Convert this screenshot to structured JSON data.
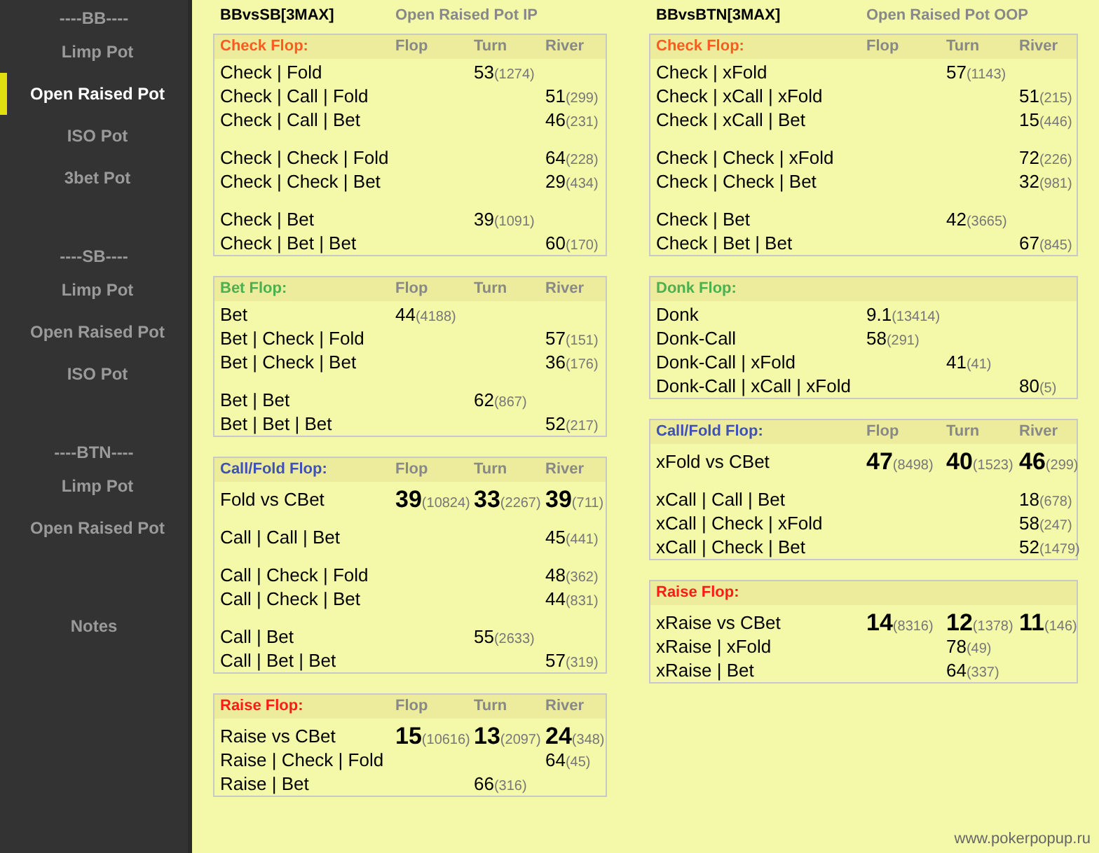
{
  "sidebar": {
    "groups": [
      {
        "heading": "----BB----",
        "items": [
          {
            "label": "Limp Pot",
            "selected": false
          },
          {
            "label": "Open Raised Pot",
            "selected": true
          },
          {
            "label": "ISO Pot",
            "selected": false
          },
          {
            "label": "3bet Pot",
            "selected": false
          }
        ]
      },
      {
        "heading": "----SB----",
        "items": [
          {
            "label": "Limp Pot",
            "selected": false
          },
          {
            "label": "Open Raised Pot",
            "selected": false
          },
          {
            "label": "ISO Pot",
            "selected": false
          }
        ]
      },
      {
        "heading": "----BTN----",
        "items": [
          {
            "label": "Limp Pot",
            "selected": false
          },
          {
            "label": "Open Raised Pot",
            "selected": false
          }
        ]
      }
    ],
    "notes": "Notes"
  },
  "panels": [
    {
      "title": "BBvsSB[3MAX]",
      "subtitle": "Open Raised Pot IP",
      "sections": [
        {
          "title": "Check Flop:",
          "color": "#ff5a1f",
          "columns": [
            "Flop",
            "Turn",
            "River"
          ],
          "row_groups": [
            [
              {
                "label": "Check | Fold",
                "emphasis": false,
                "cells": [
                  null,
                  {
                    "value": "53",
                    "count": "(1274)"
                  },
                  null
                ]
              },
              {
                "label": "Check | Call | Fold",
                "emphasis": false,
                "cells": [
                  null,
                  null,
                  {
                    "value": "51",
                    "count": "(299)"
                  }
                ]
              },
              {
                "label": "Check | Call | Bet",
                "emphasis": false,
                "cells": [
                  null,
                  null,
                  {
                    "value": "46",
                    "count": "(231)"
                  }
                ]
              }
            ],
            [
              {
                "label": "Check | Check | Fold",
                "emphasis": false,
                "cells": [
                  null,
                  null,
                  {
                    "value": "64",
                    "count": "(228)"
                  }
                ]
              },
              {
                "label": "Check | Check | Bet",
                "emphasis": false,
                "cells": [
                  null,
                  null,
                  {
                    "value": "29",
                    "count": "(434)"
                  }
                ]
              }
            ],
            [
              {
                "label": "Check | Bet",
                "emphasis": false,
                "cells": [
                  null,
                  {
                    "value": "39",
                    "count": "(1091)"
                  },
                  null
                ]
              },
              {
                "label": "Check | Bet | Bet",
                "emphasis": false,
                "cells": [
                  null,
                  null,
                  {
                    "value": "60",
                    "count": "(170)"
                  }
                ]
              }
            ]
          ]
        },
        {
          "title": "Bet Flop:",
          "color": "#4caf50",
          "columns": [
            "Flop",
            "Turn",
            "River"
          ],
          "row_groups": [
            [
              {
                "label": "Bet",
                "emphasis": false,
                "cells": [
                  {
                    "value": "44",
                    "count": "(4188)"
                  },
                  null,
                  null
                ]
              },
              {
                "label": "Bet | Check | Fold",
                "emphasis": false,
                "cells": [
                  null,
                  null,
                  {
                    "value": "57",
                    "count": "(151)"
                  }
                ]
              },
              {
                "label": "Bet | Check | Bet",
                "emphasis": false,
                "cells": [
                  null,
                  null,
                  {
                    "value": "36",
                    "count": "(176)"
                  }
                ]
              }
            ],
            [
              {
                "label": "Bet | Bet",
                "emphasis": false,
                "cells": [
                  null,
                  {
                    "value": "62",
                    "count": "(867)"
                  },
                  null
                ]
              },
              {
                "label": "Bet | Bet | Bet",
                "emphasis": false,
                "cells": [
                  null,
                  null,
                  {
                    "value": "52",
                    "count": "(217)"
                  }
                ]
              }
            ]
          ]
        },
        {
          "title": "Call/Fold Flop:",
          "color": "#3f51b5",
          "columns": [
            "Flop",
            "Turn",
            "River"
          ],
          "row_groups": [
            [
              {
                "label": "Fold vs CBet",
                "emphasis": true,
                "cells": [
                  {
                    "value": "39",
                    "count": "(10824)"
                  },
                  {
                    "value": "33",
                    "count": "(2267)"
                  },
                  {
                    "value": "39",
                    "count": "(711)"
                  }
                ]
              }
            ],
            [
              {
                "label": "Call | Call | Bet",
                "emphasis": false,
                "cells": [
                  null,
                  null,
                  {
                    "value": "45",
                    "count": "(441)"
                  }
                ]
              }
            ],
            [
              {
                "label": "Call | Check | Fold",
                "emphasis": false,
                "cells": [
                  null,
                  null,
                  {
                    "value": "48",
                    "count": "(362)"
                  }
                ]
              },
              {
                "label": "Call | Check | Bet",
                "emphasis": false,
                "cells": [
                  null,
                  null,
                  {
                    "value": "44",
                    "count": "(831)"
                  }
                ]
              }
            ],
            [
              {
                "label": "Call | Bet",
                "emphasis": false,
                "cells": [
                  null,
                  {
                    "value": "55",
                    "count": "(2633)"
                  },
                  null
                ]
              },
              {
                "label": "Call | Bet | Bet",
                "emphasis": false,
                "cells": [
                  null,
                  null,
                  {
                    "value": "57",
                    "count": "(319)"
                  }
                ]
              }
            ]
          ]
        },
        {
          "title": "Raise Flop:",
          "color": "#ff1a1a",
          "columns": [
            "Flop",
            "Turn",
            "River"
          ],
          "row_groups": [
            [
              {
                "label": "Raise vs CBet",
                "emphasis": true,
                "cells": [
                  {
                    "value": "15",
                    "count": "(10616)"
                  },
                  {
                    "value": "13",
                    "count": "(2097)"
                  },
                  {
                    "value": "24",
                    "count": "(348)"
                  }
                ]
              },
              {
                "label": "Raise | Check | Fold",
                "emphasis": false,
                "cells": [
                  null,
                  null,
                  {
                    "value": "64",
                    "count": "(45)"
                  }
                ]
              },
              {
                "label": "Raise | Bet",
                "emphasis": false,
                "cells": [
                  null,
                  {
                    "value": "66",
                    "count": "(316)"
                  },
                  null
                ]
              }
            ]
          ]
        }
      ]
    },
    {
      "title": "BBvsBTN[3MAX]",
      "subtitle": "Open Raised Pot OOP",
      "sections": [
        {
          "title": "Check Flop:",
          "color": "#ff5a1f",
          "columns": [
            "Flop",
            "Turn",
            "River"
          ],
          "row_groups": [
            [
              {
                "label": "Check | xFold",
                "emphasis": false,
                "cells": [
                  null,
                  {
                    "value": "57",
                    "count": "(1143)"
                  },
                  null
                ]
              },
              {
                "label": "Check | xCall | xFold",
                "emphasis": false,
                "cells": [
                  null,
                  null,
                  {
                    "value": "51",
                    "count": "(215)"
                  }
                ]
              },
              {
                "label": "Check | xCall | Bet",
                "emphasis": false,
                "cells": [
                  null,
                  null,
                  {
                    "value": "15",
                    "count": "(446)"
                  }
                ]
              }
            ],
            [
              {
                "label": "Check | Check | xFold",
                "emphasis": false,
                "cells": [
                  null,
                  null,
                  {
                    "value": "72",
                    "count": "(226)"
                  }
                ]
              },
              {
                "label": "Check | Check | Bet",
                "emphasis": false,
                "cells": [
                  null,
                  null,
                  {
                    "value": "32",
                    "count": "(981)"
                  }
                ]
              }
            ],
            [
              {
                "label": "Check | Bet",
                "emphasis": false,
                "cells": [
                  null,
                  {
                    "value": "42",
                    "count": "(3665)"
                  },
                  null
                ]
              },
              {
                "label": "Check | Bet | Bet",
                "emphasis": false,
                "cells": [
                  null,
                  null,
                  {
                    "value": "67",
                    "count": "(845)"
                  }
                ]
              }
            ]
          ]
        },
        {
          "title": "Donk Flop:",
          "color": "#4caf50",
          "row_groups": [
            [
              {
                "label": "Donk",
                "emphasis": false,
                "cells": [
                  {
                    "value": "9.1",
                    "count": "(13414)"
                  },
                  null,
                  null
                ]
              },
              {
                "label": "Donk-Call",
                "emphasis": false,
                "cells": [
                  {
                    "value": "58",
                    "count": "(291)"
                  },
                  null,
                  null
                ]
              },
              {
                "label": "Donk-Call | xFold",
                "emphasis": false,
                "cells": [
                  null,
                  {
                    "value": "41",
                    "count": "(41)"
                  },
                  null
                ]
              },
              {
                "label": "Donk-Call | xCall | xFold",
                "emphasis": false,
                "cells": [
                  null,
                  null,
                  {
                    "value": "80",
                    "count": "(5)"
                  }
                ]
              }
            ]
          ]
        },
        {
          "title": "Call/Fold Flop:",
          "color": "#3f51b5",
          "columns": [
            "Flop",
            "Turn",
            "River"
          ],
          "row_groups": [
            [
              {
                "label": "xFold vs CBet",
                "emphasis": true,
                "cells": [
                  {
                    "value": "47",
                    "count": "(8498)"
                  },
                  {
                    "value": "40",
                    "count": "(1523)"
                  },
                  {
                    "value": "46",
                    "count": "(299)"
                  }
                ]
              }
            ],
            [
              {
                "label": "xCall | Call | Bet",
                "emphasis": false,
                "cells": [
                  null,
                  null,
                  {
                    "value": "18",
                    "count": "(678)"
                  }
                ]
              },
              {
                "label": "xCall | Check | xFold",
                "emphasis": false,
                "cells": [
                  null,
                  null,
                  {
                    "value": "58",
                    "count": "(247)"
                  }
                ]
              },
              {
                "label": "xCall | Check | Bet",
                "emphasis": false,
                "cells": [
                  null,
                  null,
                  {
                    "value": "52",
                    "count": "(1479)"
                  }
                ]
              }
            ]
          ]
        },
        {
          "title": "Raise Flop:",
          "color": "#ff1a1a",
          "row_groups": [
            [
              {
                "label": "xRaise vs CBet",
                "emphasis": true,
                "cells": [
                  {
                    "value": "14",
                    "count": "(8316)"
                  },
                  {
                    "value": "12",
                    "count": "(1378)"
                  },
                  {
                    "value": "11",
                    "count": "(146)"
                  }
                ]
              },
              {
                "label": "xRaise | xFold",
                "emphasis": false,
                "cells": [
                  null,
                  {
                    "value": "78",
                    "count": "(49)"
                  },
                  null
                ]
              },
              {
                "label": "xRaise | Bet",
                "emphasis": false,
                "cells": [
                  null,
                  {
                    "value": "64",
                    "count": "(337)"
                  },
                  null
                ]
              }
            ]
          ]
        }
      ]
    }
  ],
  "footer": "www.pokerpopup.ru"
}
